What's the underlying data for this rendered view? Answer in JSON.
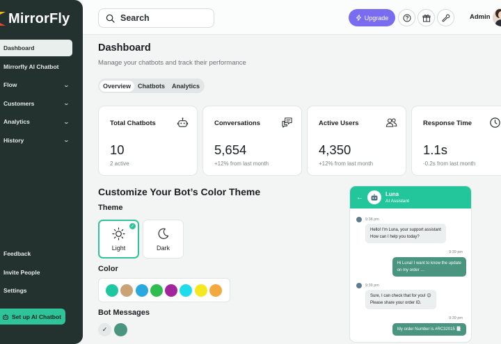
{
  "brand": {
    "name": "MirrorFly"
  },
  "sidebar": {
    "items": [
      {
        "label": "Dashboard",
        "active": true,
        "has_chevron": false
      },
      {
        "label": "Mirrorfly AI Chatbot",
        "active": false,
        "has_chevron": false
      },
      {
        "label": "Flow",
        "active": false,
        "has_chevron": true
      },
      {
        "label": "Customers",
        "active": false,
        "has_chevron": true
      },
      {
        "label": "Analytics",
        "active": false,
        "has_chevron": true
      },
      {
        "label": "History",
        "active": false,
        "has_chevron": true
      }
    ],
    "bottom_items": [
      {
        "label": "Feedback"
      },
      {
        "label": "Invite People"
      },
      {
        "label": "Settings"
      }
    ],
    "cta_label": "Set up AI Chatbot"
  },
  "header": {
    "search_placeholder": "Search",
    "upgrade_label": "Upgrade",
    "user_name": "Admin",
    "icons": [
      "help-icon",
      "gift-icon",
      "wrench-icon"
    ]
  },
  "dashboard": {
    "title": "Dashboard",
    "subtitle": "Manage your chatbots and track their performance",
    "tabs": [
      "Overview",
      "Chatbots",
      "Analytics"
    ],
    "active_tab": "Overview"
  },
  "stats": [
    {
      "title": "Total Chatbots",
      "value": "10",
      "sub": "2 active",
      "icon": "robot-icon"
    },
    {
      "title": "Conversations",
      "value": "5,654",
      "sub": "+12% from last month",
      "icon": "chat-bubbles-icon"
    },
    {
      "title": "Active Users",
      "value": "4,350",
      "sub": "+12% from last month",
      "icon": "users-icon"
    },
    {
      "title": "Response Time",
      "value": "1.1s",
      "sub": "-0.2s from last month",
      "icon": "clock-icon"
    }
  ],
  "customize": {
    "title": "Customize Your Bot’s Color Theme",
    "theme_label": "Theme",
    "themes": [
      {
        "label": "Light",
        "selected": true
      },
      {
        "label": "Dark",
        "selected": false
      }
    ],
    "color_label": "Color",
    "colors": [
      "#1fc7a0",
      "#c9a376",
      "#2aa8e0",
      "#2ebd4e",
      "#a3259e",
      "#1fdcea",
      "#f6e81e",
      "#f3a93d"
    ],
    "bot_messages_label": "Bot Messages",
    "bot_message_colors": [
      "#e4e8e8",
      "#4a9580"
    ]
  },
  "chat_preview": {
    "bot_name": "Luna",
    "bot_role": "AI Assistant",
    "messages": [
      {
        "from": "bot",
        "time": "9:38 pm",
        "text": "Hello! I'm Luna, your support assistant\nHow can I help you today?"
      },
      {
        "from": "user",
        "time": "9:39 pm",
        "text": "Hi Luna! I want to know the update\non my order …"
      },
      {
        "from": "bot",
        "time": "9:39 pm",
        "text": "Sure, I can check that for you! 😊\nPlease share your order ID."
      },
      {
        "from": "user",
        "time": "9:39 pm",
        "text": "My order Number is #RC32015 📑"
      }
    ]
  },
  "colors": {
    "sidebar_bg": "#23312f",
    "accent": "#2fc39a",
    "upgrade": "#7a6cf0"
  }
}
